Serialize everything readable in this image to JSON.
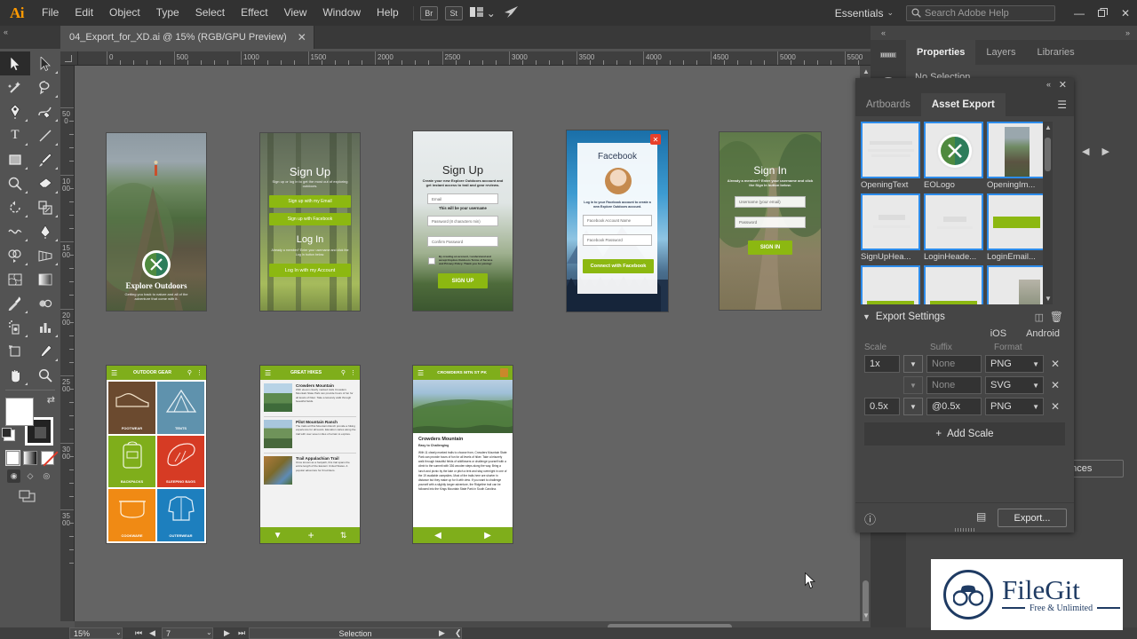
{
  "app": {
    "logo": "Ai",
    "menus": [
      "File",
      "Edit",
      "Object",
      "Type",
      "Select",
      "Effect",
      "View",
      "Window",
      "Help"
    ],
    "quick_buttons": [
      "Br",
      "St"
    ],
    "arrange_icon": "arrange-documents-icon",
    "arrange_caret": "⌄",
    "share_icon": "share-icon",
    "workspace": "Essentials",
    "workspace_caret": "⌄",
    "search_placeholder": "Search Adobe Help",
    "search_icon": "search-icon",
    "window_buttons": {
      "minimize": "—",
      "restore": "❐",
      "close": "✕"
    }
  },
  "document_tab": {
    "title": "04_Export_for_XD.ai @ 15% (RGB/GPU Preview)",
    "close": "✕"
  },
  "toolbar": {
    "tools": [
      {
        "name": "selection-tool",
        "glyph": "selection",
        "selected": true
      },
      {
        "name": "direct-selection-tool",
        "glyph": "direct-selection",
        "selected": false
      },
      {
        "name": "magic-wand-tool",
        "glyph": "magic-wand",
        "selected": false
      },
      {
        "name": "lasso-tool",
        "glyph": "lasso",
        "selected": false
      },
      {
        "name": "pen-tool",
        "glyph": "pen",
        "selected": false
      },
      {
        "name": "curvature-tool",
        "glyph": "curvature",
        "selected": false
      },
      {
        "name": "type-tool",
        "glyph": "type",
        "selected": false
      },
      {
        "name": "line-segment-tool",
        "glyph": "line",
        "selected": false
      },
      {
        "name": "rectangle-tool",
        "glyph": "rectangle",
        "selected": false
      },
      {
        "name": "paintbrush-tool",
        "glyph": "paintbrush",
        "selected": false
      },
      {
        "name": "shaper-tool",
        "glyph": "shaper",
        "selected": false
      },
      {
        "name": "eraser-tool",
        "glyph": "eraser",
        "selected": false
      },
      {
        "name": "rotate-tool",
        "glyph": "rotate",
        "selected": false
      },
      {
        "name": "scale-tool",
        "glyph": "scale",
        "selected": false
      },
      {
        "name": "width-tool",
        "glyph": "width",
        "selected": false
      },
      {
        "name": "free-transform-tool",
        "glyph": "free-transform",
        "selected": false
      },
      {
        "name": "shape-builder-tool",
        "glyph": "shape-builder",
        "selected": false
      },
      {
        "name": "perspective-grid-tool",
        "glyph": "perspective-grid",
        "selected": false
      },
      {
        "name": "mesh-tool",
        "glyph": "mesh",
        "selected": false
      },
      {
        "name": "gradient-tool",
        "glyph": "gradient",
        "selected": false
      },
      {
        "name": "eyedropper-tool",
        "glyph": "eyedropper",
        "selected": false
      },
      {
        "name": "blend-tool",
        "glyph": "blend",
        "selected": false
      },
      {
        "name": "symbol-sprayer-tool",
        "glyph": "symbol-sprayer",
        "selected": false
      },
      {
        "name": "column-graph-tool",
        "glyph": "column-graph",
        "selected": false
      },
      {
        "name": "artboard-tool",
        "glyph": "artboard",
        "selected": false
      },
      {
        "name": "slice-tool",
        "glyph": "slice",
        "selected": false
      },
      {
        "name": "hand-tool",
        "glyph": "hand",
        "selected": false
      },
      {
        "name": "zoom-tool",
        "glyph": "zoom",
        "selected": false
      }
    ],
    "fill_color": "#ffffff",
    "stroke_color": "#000000",
    "swap_icon": "swap-fill-stroke-icon",
    "default_icon": "default-fill-stroke-icon",
    "paint_modes": [
      "color-swatch",
      "gradient-swatch",
      "none-swatch"
    ],
    "draw_modes": [
      "draw-normal",
      "draw-behind",
      "draw-inside"
    ],
    "screen_mode": "change-screen-mode-icon"
  },
  "rulers": {
    "horizontal_labels": [
      "0",
      "500",
      "1000",
      "1500",
      "2000",
      "2500",
      "3000",
      "3500",
      "4000",
      "4500",
      "5000",
      "5500"
    ],
    "vertical_labels": [
      "500",
      "1000",
      "1500",
      "2000",
      "2500",
      "3000",
      "3500"
    ]
  },
  "artboards": [
    {
      "name": "opening-screen",
      "title": "Explore Outdoors",
      "subtitle": "Getting you back to nature and all of the adventure that come with it.",
      "logo_label": "EOLogo"
    },
    {
      "name": "signup-choice-screen",
      "title": "Sign Up",
      "subtitle": "Sign up or log in to get the most out of exploring outdoors.",
      "buttons": [
        "Sign up with my Email",
        "Sign up with Facebook",
        "Log In with my Account"
      ],
      "secondary_title": "Log In",
      "secondary_subtitle": "Already a member? Enter your username and click the Log In button below."
    },
    {
      "name": "signup-form-screen",
      "title": "Sign Up",
      "subtitle": "Create your new Explore Outdoors account and get instant access to trail and gear reviews.",
      "fields": [
        "Email",
        "Password (8 characters min)",
        "Confirm Password"
      ],
      "helper_text": "This will be your username",
      "checkbox_text": "By creating an account, I understand and accept Explore Outdoors Terms of Service and Privacy Policy. Thank you for joining!",
      "submit": "SIGN UP"
    },
    {
      "name": "facebook-connect-screen",
      "title": "Facebook",
      "subtitle": "Log in to your Facebook account to create a new Explore Outdoors account.",
      "fields": [
        "Facebook Account Name",
        "Facebook Password"
      ],
      "submit": "Connect with Facebook",
      "close_badge": "✕"
    },
    {
      "name": "signin-screen",
      "title": "Sign In",
      "subtitle": "Already a member? Enter your username and click the Sign In button below.",
      "fields": [
        "Username (your email)",
        "Password"
      ],
      "submit": "SIGN IN"
    },
    {
      "name": "outdoor-gear-screen",
      "header": "OUTDOOR GEAR",
      "menu_icon": "hamburger-icon",
      "search_icon": "search-icon",
      "overflow_icon": "overflow-menu-icon",
      "tiles": [
        {
          "label": "FOOTWEAR",
          "color": "#6b4a2f"
        },
        {
          "label": "TENTS",
          "color": "#5f92ad"
        },
        {
          "label": "BACKPACKS",
          "color": "#7fae1b"
        },
        {
          "label": "SLEEPING BAGS",
          "color": "#d63b24"
        },
        {
          "label": "COOKWARE",
          "color": "#f08a14"
        },
        {
          "label": "OUTERWEAR",
          "color": "#1d7fbe"
        }
      ]
    },
    {
      "name": "great-hikes-screen",
      "header": "GREAT HIKES",
      "menu_icon": "hamburger-icon",
      "search_icon": "search-icon",
      "overflow_icon": "overflow-menu-icon",
      "list": [
        {
          "title": "Crowders Mountain",
          "desc": "With eleven clearly marked trails Crowders Mountain State Park can provide hours of fun for all levels of hiker. Take a leisurely walk through beautiful fields."
        },
        {
          "title": "Pilot Mountain Ranch",
          "desc": "The trails at Pilot Mountain Ranch provide a hiking experience for all levels. Elevation varies along the trail with over seven miles of terrain to explore."
        },
        {
          "title": "Trail Appalachian Trail",
          "desc": "Once known as a footpath, this trail spans the entire length of the Eastern United States. A popular adventure for thru-hikers."
        }
      ],
      "toolbar_icons": [
        "filter-icon",
        "add-icon",
        "sort-icon"
      ]
    },
    {
      "name": "crowders-detail-screen",
      "header": "CROWDERS MTN ST PK",
      "menu_icon": "hamburger-icon",
      "badge_icon": "park-badge-icon",
      "title": "Crowders Mountain",
      "subtitle": "Easy to Challenging",
      "body": "With 11 clearly marked trails to choose from, Crowders Mountain State Park can provide hours of fun for all levels of hiker. Take a leisurely walk through beautiful fields of wildflowers or challenge yourself with a climb to the summit with 336 wooden steps along the way. Bring a lunch and picnic by the lake or pitch a tent and stay overnight in one of the 19 available campsites.  Most of the trails here are shorter in distance but they make up for it with view. If you want to challenge yourself with a slightly longer adventure, the Ridgeline trail can be followed into the Kings Mountain State Park in South Carolina.",
      "prev_icon": "previous-icon",
      "next_icon": "next-icon"
    }
  ],
  "properties_panel": {
    "tabs": [
      "Properties",
      "Layers",
      "Libraries"
    ],
    "active_tab": "Properties",
    "status": "No Selection",
    "hidden_button": "ences"
  },
  "asset_export": {
    "tabs": [
      "Artboards",
      "Asset Export"
    ],
    "active_tab": "Asset Export",
    "menu_icon": "panel-menu-icon",
    "collapse_icon": "«",
    "close_icon": "✕",
    "assets": [
      {
        "label": "OpeningText",
        "thumb": "text-lines",
        "selected": true
      },
      {
        "label": "EOLogo",
        "thumb": "eo-logo",
        "selected": true
      },
      {
        "label": "OpeningIm...",
        "thumb": "mountain-photo",
        "selected": true
      },
      {
        "label": "SignUpHea...",
        "thumb": "signup-heading",
        "selected": true
      },
      {
        "label": "LoginHeade...",
        "thumb": "login-heading",
        "selected": true
      },
      {
        "label": "LoginEmail...",
        "thumb": "green-button",
        "selected": true
      },
      {
        "label": "",
        "thumb": "facebook-button",
        "selected": true
      },
      {
        "label": "",
        "thumb": "email-button",
        "selected": true
      },
      {
        "label": "",
        "thumb": "forest-photo",
        "selected": true
      }
    ],
    "settings_header": "Export Settings",
    "settings_triangle": "▼",
    "generate_icon": "generate-assets-icon",
    "delete_icon": "delete-icon",
    "platforms": [
      "iOS",
      "Android"
    ],
    "columns": [
      "Scale",
      "Suffix",
      "Format"
    ],
    "rows": [
      {
        "scale": "1x",
        "suffix": "",
        "suffix_placeholder": "None",
        "format": "PNG"
      },
      {
        "scale": "",
        "suffix": "",
        "suffix_placeholder": "None",
        "format": "SVG"
      },
      {
        "scale": "0.5x",
        "suffix": "@0.5x",
        "suffix_placeholder": "None",
        "format": "PNG"
      }
    ],
    "add_scale": "Add Scale",
    "add_scale_icon": "+",
    "info_icon": "info-icon",
    "list_icon": "export-list-icon",
    "export_button": "Export..."
  },
  "statusbar": {
    "zoom": "15%",
    "zoom_caret": "⌄",
    "first_icon": "⏮",
    "prev_icon": "◀",
    "page": "7",
    "page_caret": "⌄",
    "next_icon": "▶",
    "last_icon": "⏭",
    "status_text": "Selection",
    "status_arrow": "▶",
    "resize_icon": "⤣"
  },
  "watermark": {
    "name": "FileGit",
    "tagline": "Free & Unlimited",
    "logo": "binoculars-icon"
  },
  "colors": {
    "accent_green": "#8cb811",
    "selection_blue": "#2d8ceb",
    "ui_dark": "#323232",
    "ui_panel": "#454545",
    "canvas": "#646464",
    "brand_navy": "#1f3b63"
  }
}
